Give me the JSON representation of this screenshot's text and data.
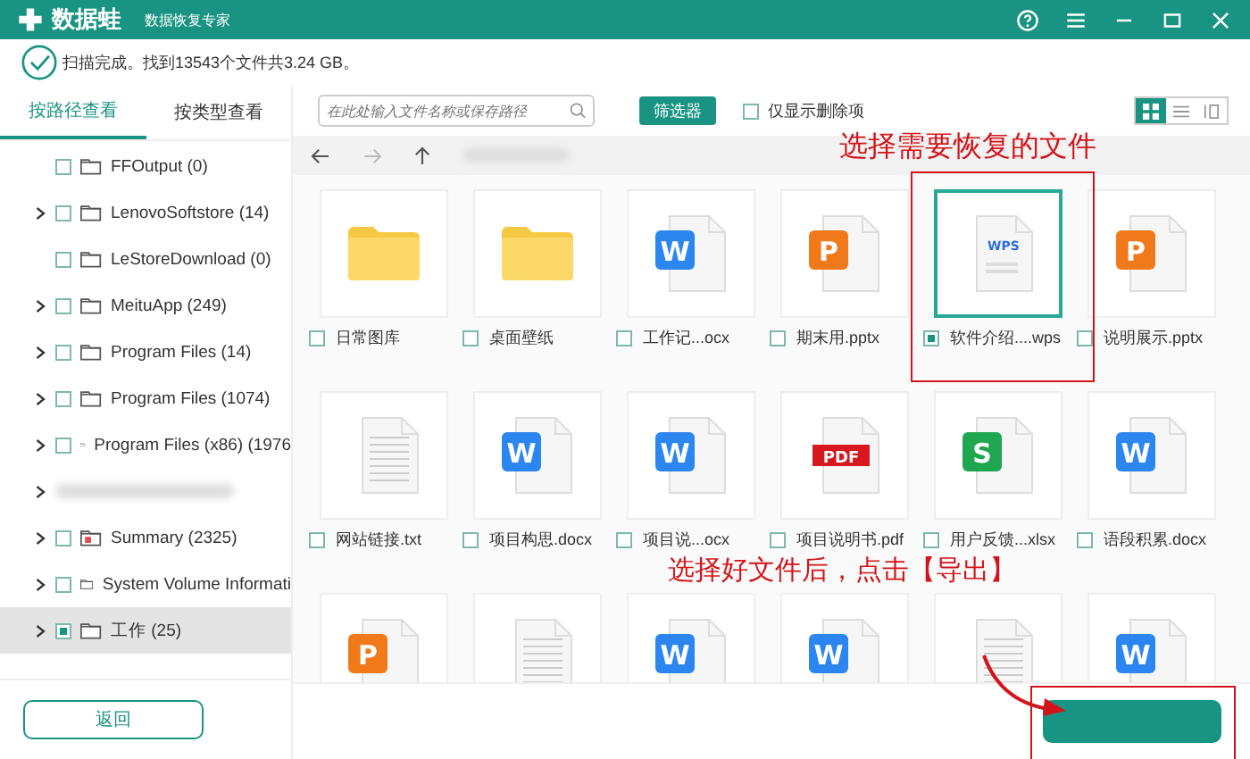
{
  "app": {
    "name": "数据蛙",
    "subtitle": "数据恢复专家"
  },
  "status": "扫描完成。找到13543个文件共3.24 GB。",
  "tabs": [
    {
      "label": "按路径查看",
      "selected": true
    },
    {
      "label": "按类型查看",
      "selected": false
    }
  ],
  "tree": [
    {
      "kind": "folder",
      "label": "FFOutput (0)",
      "expandable": false,
      "checked": false,
      "selected": false
    },
    {
      "kind": "folder",
      "label": "LenovoSoftstore (14)",
      "expandable": true,
      "checked": false,
      "selected": false
    },
    {
      "kind": "folder",
      "label": "LeStoreDownload (0)",
      "expandable": false,
      "checked": false,
      "selected": false
    },
    {
      "kind": "folder",
      "label": "MeituApp (249)",
      "expandable": true,
      "checked": false,
      "selected": false
    },
    {
      "kind": "folder",
      "label": "Program Files (14)",
      "expandable": true,
      "checked": false,
      "selected": false
    },
    {
      "kind": "folder",
      "label": "Program Files (1074)",
      "expandable": true,
      "checked": false,
      "selected": false
    },
    {
      "kind": "folder",
      "label": "Program Files (x86) (1976",
      "expandable": true,
      "checked": false,
      "selected": false
    },
    {
      "kind": "redacted",
      "expandable": true,
      "selected": false
    },
    {
      "kind": "special",
      "label": "Summary (2325)",
      "expandable": true,
      "checked": false,
      "selected": false
    },
    {
      "kind": "folder",
      "label": "System Volume Informati",
      "expandable": true,
      "checked": false,
      "selected": false
    },
    {
      "kind": "folder",
      "label": "工作 (25)",
      "expandable": true,
      "checked": true,
      "selected": true
    }
  ],
  "back_button": "返回",
  "search": {
    "placeholder": "在此处输入文件名称或保存路径"
  },
  "filter_button": "筛选器",
  "deleted_only": {
    "label": "仅显示删除项",
    "checked": false
  },
  "views": [
    {
      "kind": "grid",
      "selected": true
    },
    {
      "kind": "list",
      "selected": false
    },
    {
      "kind": "detail",
      "selected": false
    }
  ],
  "files": [
    {
      "kind": "folder",
      "name": "日常图库",
      "checked": false,
      "selected": false
    },
    {
      "kind": "folder",
      "name": "桌面壁纸",
      "checked": false,
      "selected": false
    },
    {
      "kind": "badge-doc",
      "badge": "W",
      "color": "#2b86f0",
      "name": "工作记...ocx",
      "checked": false,
      "selected": false
    },
    {
      "kind": "badge-doc",
      "badge": "P",
      "color": "#f07a1a",
      "name": "期末用.pptx",
      "checked": false,
      "selected": false
    },
    {
      "kind": "plain-doc",
      "badge": "WPS",
      "name": "软件介绍....wps",
      "checked": true,
      "selected": true
    },
    {
      "kind": "badge-doc",
      "badge": "P",
      "color": "#f07a1a",
      "name": "说明展示.pptx",
      "checked": false,
      "selected": false
    },
    {
      "kind": "lines-doc",
      "name": "网站链接.txt",
      "checked": false,
      "selected": false
    },
    {
      "kind": "badge-doc",
      "badge": "W",
      "color": "#2b86f0",
      "name": "项目构思.docx",
      "checked": false,
      "selected": false
    },
    {
      "kind": "badge-doc",
      "badge": "W",
      "color": "#2b86f0",
      "name": "项目说...ocx",
      "checked": false,
      "selected": false
    },
    {
      "kind": "banner-doc",
      "badge": "PDF",
      "color": "#d7191f",
      "name": "项目说明书.pdf",
      "checked": false,
      "selected": false
    },
    {
      "kind": "badge-doc",
      "badge": "S",
      "color": "#1fa650",
      "name": "用户反馈...xlsx",
      "checked": false,
      "selected": false
    },
    {
      "kind": "badge-doc",
      "badge": "W",
      "color": "#2b86f0",
      "name": "语段积累.docx",
      "checked": false,
      "selected": false
    },
    {
      "kind": "badge-doc",
      "badge": "P",
      "color": "#f07a1a",
      "selected": false
    },
    {
      "kind": "lines-doc",
      "selected": false
    },
    {
      "kind": "badge-doc",
      "badge": "W",
      "color": "#2b86f0",
      "selected": false
    },
    {
      "kind": "badge-doc",
      "badge": "W",
      "color": "#2b86f0",
      "selected": false
    },
    {
      "kind": "lines-doc",
      "selected": false
    },
    {
      "kind": "badge-doc",
      "badge": "W",
      "color": "#2b86f0",
      "selected": false
    }
  ],
  "annotations": [
    "选择需要恢复的文件",
    "选择好文件后，点击【导出】"
  ]
}
